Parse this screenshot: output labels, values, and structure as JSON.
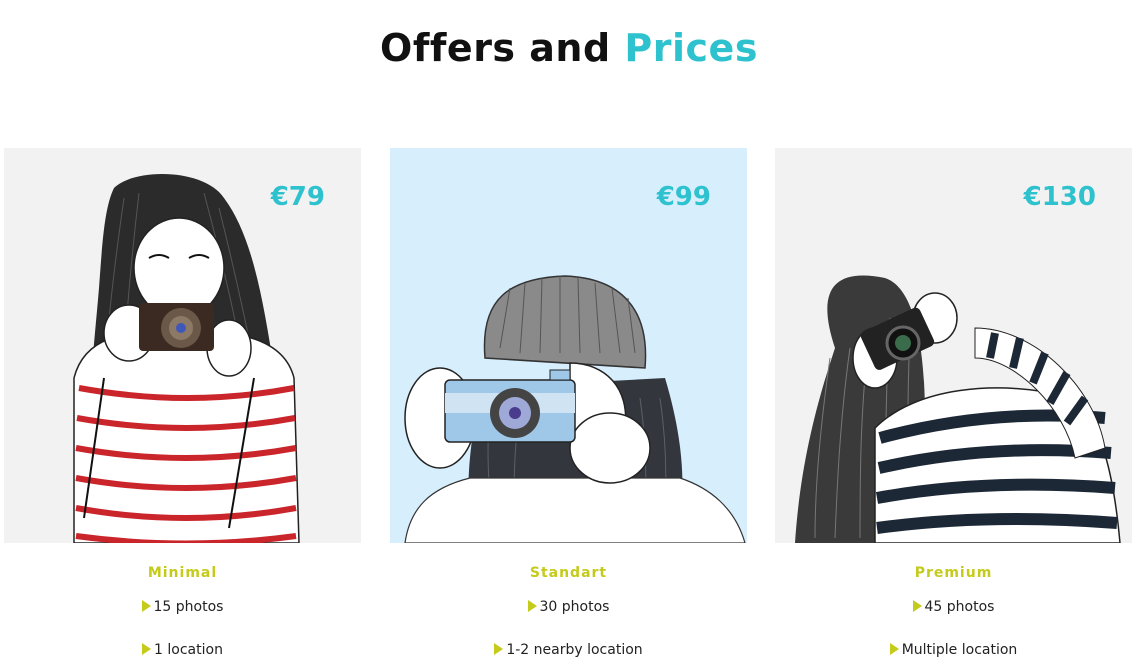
{
  "header": {
    "title_part1": "Offers and",
    "title_part2": "Prices"
  },
  "colors": {
    "accent_teal": "#2ec2cf",
    "accent_lime": "#c5cb1a",
    "card_gray": "#f2f2f2",
    "card_blue": "#d7eefc"
  },
  "plans": [
    {
      "price": "€79",
      "name": "Minimal",
      "features": [
        "15 photos",
        "1 location"
      ],
      "illustration": "girl-with-camera-red-stripes"
    },
    {
      "price": "€99",
      "name": "Standart",
      "features": [
        "30 photos",
        "1-2 nearby location"
      ],
      "illustration": "girl-with-camera-beanie"
    },
    {
      "price": "€130",
      "name": "Premium",
      "features": [
        "45 photos",
        "Multiple location"
      ],
      "illustration": "girl-with-camera-navy-stripes"
    }
  ],
  "icons": {
    "bullet": "triangle-bullet-icon"
  }
}
